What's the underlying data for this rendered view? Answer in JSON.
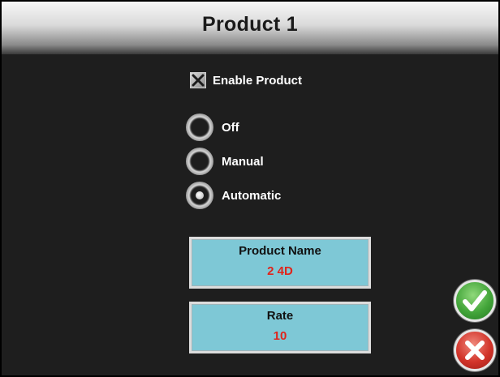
{
  "header": {
    "title": "Product 1"
  },
  "enable_product": {
    "label": "Enable Product",
    "checked": true
  },
  "mode": {
    "options": [
      "Off",
      "Manual",
      "Automatic"
    ],
    "selected": "Automatic"
  },
  "product_name": {
    "label": "Product Name",
    "value": "2 4D"
  },
  "rate": {
    "label": "Rate",
    "value": "10"
  },
  "actions": {
    "confirm_icon": "checkmark-icon",
    "cancel_icon": "x-icon"
  },
  "colors": {
    "background": "#1e1e1e",
    "field_fill": "#7ec8d6",
    "value_text": "#e0241b",
    "confirm": "#43a53a",
    "cancel": "#d2342a"
  }
}
